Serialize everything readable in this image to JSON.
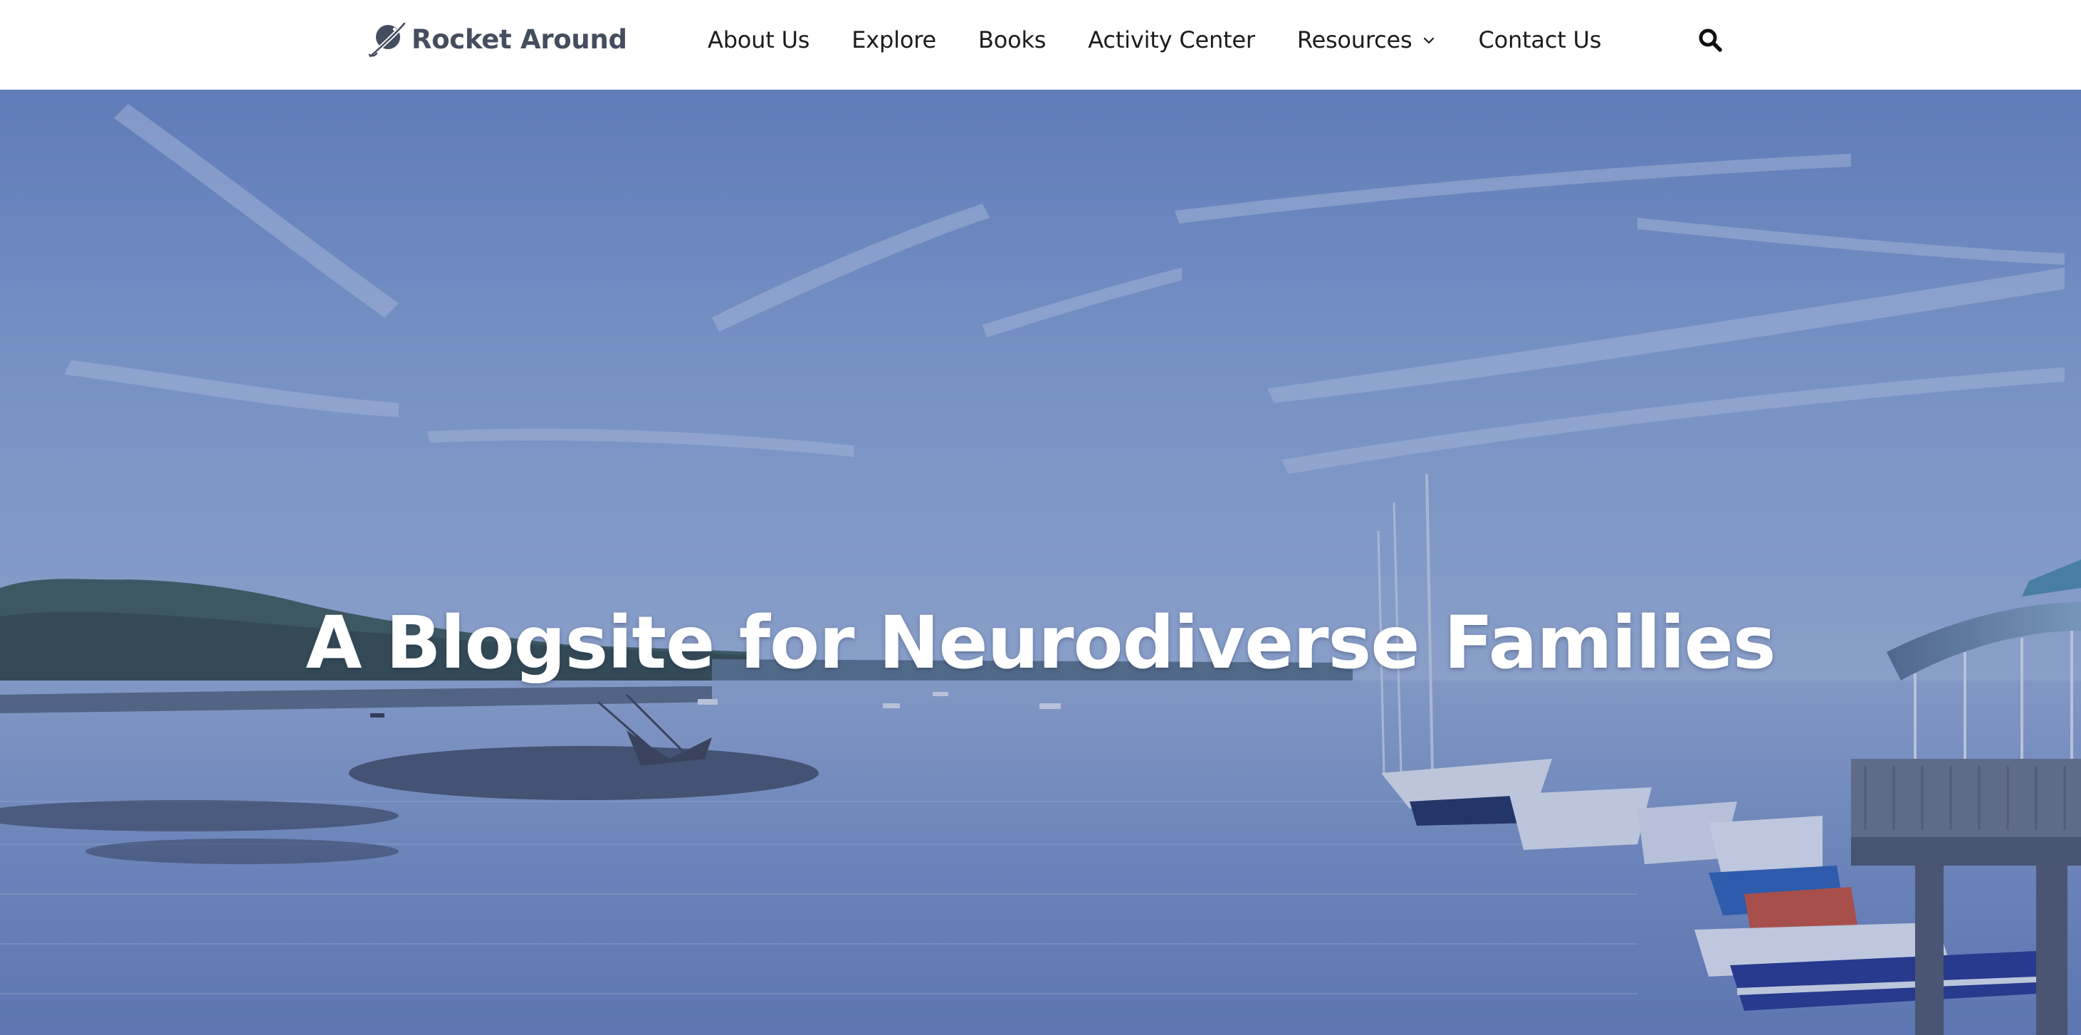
{
  "header": {
    "logo_text": "Rocket Around",
    "logo_icon": "planet-rocket-icon",
    "search_icon": "search-icon"
  },
  "nav": {
    "items": [
      {
        "label": "About Us"
      },
      {
        "label": "Explore"
      },
      {
        "label": "Books"
      },
      {
        "label": "Activity Center"
      },
      {
        "label": "Resources",
        "has_dropdown": true
      },
      {
        "label": "Contact Us"
      }
    ]
  },
  "hero": {
    "title": "A Blogsite for Neurodiverse Families"
  },
  "colors": {
    "nav_text": "#1c1c1c",
    "logo_text": "#454e5e",
    "hero_overlay": "#3a5296",
    "hero_title": "#ffffff"
  }
}
